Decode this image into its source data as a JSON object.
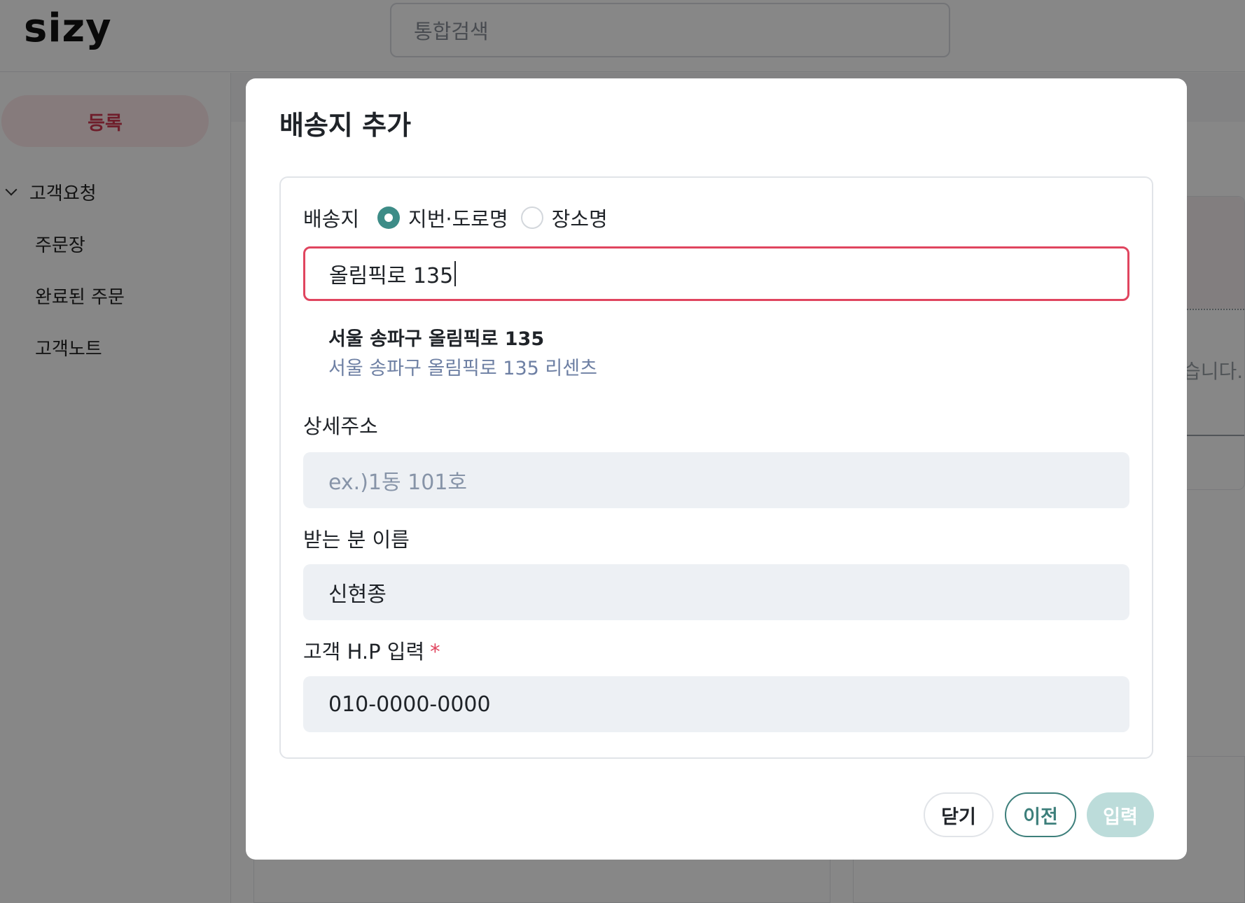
{
  "header": {
    "logo": "sizy",
    "search_placeholder": "통합검색"
  },
  "sidebar": {
    "register_label": "등록",
    "group_label": "고객요청",
    "items": [
      {
        "label": "주문장"
      },
      {
        "label": "완료된 주문"
      },
      {
        "label": "고객노트"
      }
    ]
  },
  "background": {
    "partial_text": "습니다."
  },
  "modal": {
    "title": "배송지 추가",
    "address": {
      "label": "배송지",
      "options": [
        {
          "label": "지번·도로명",
          "selected": true
        },
        {
          "label": "장소명",
          "selected": false
        }
      ],
      "input_value": "올림픽로 135",
      "suggestion_title": "서울 송파구 올림픽로 135",
      "suggestion_subtitle": "서울 송파구 올림픽로 135 리센츠"
    },
    "detail": {
      "label": "상세주소",
      "placeholder": "ex.)1동 101호"
    },
    "recipient": {
      "label": "받는 분 이름",
      "value": "신현종"
    },
    "phone": {
      "label": "고객 H.P 입력",
      "required_mark": "*",
      "value": "010-0000-0000"
    },
    "buttons": {
      "close": "닫기",
      "prev": "이전",
      "submit": "입력"
    }
  },
  "colors": {
    "accent": "#3d8c87",
    "error": "#e0455f",
    "field_bg": "#edf0f4",
    "overlay": "rgba(0,0,0,0.47)"
  }
}
